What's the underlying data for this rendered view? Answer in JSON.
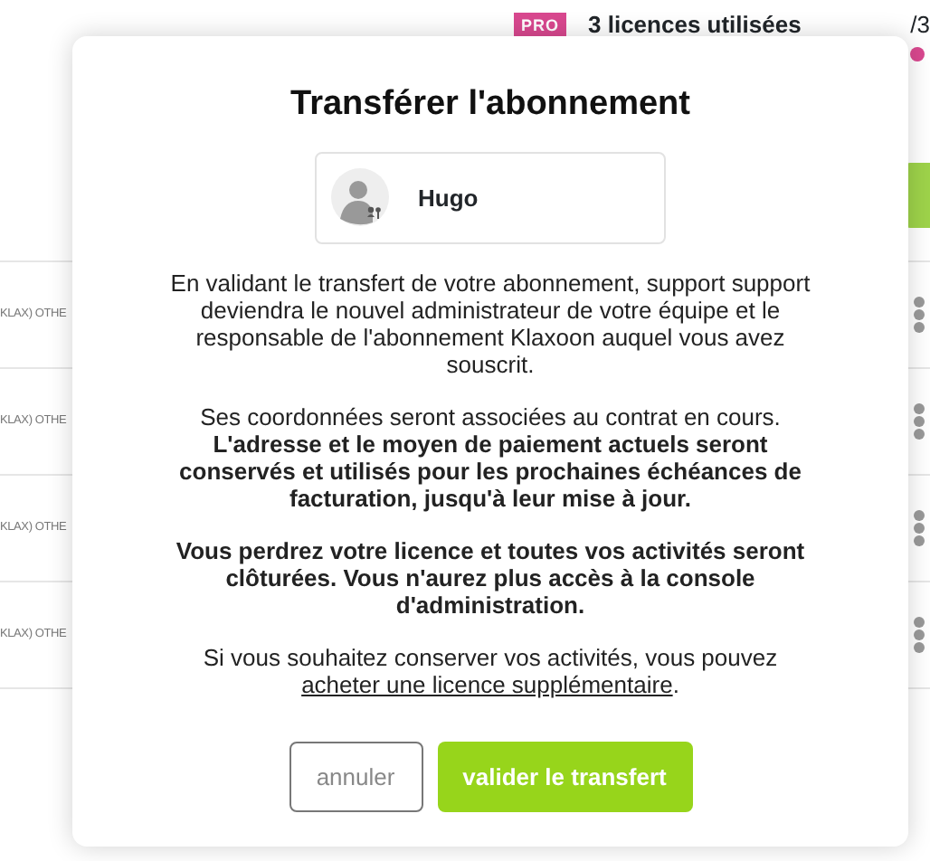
{
  "header": {
    "badge": "PRO",
    "licenses": "3 licences utilisées",
    "count": "/3"
  },
  "rows": [
    {
      "label": "KLAX) OTHE"
    },
    {
      "label": "KLAX) OTHE"
    },
    {
      "label": "KLAX) OTHE"
    },
    {
      "label": "KLAX) OTHE"
    }
  ],
  "dialog": {
    "title": "Transférer l'abonnement",
    "user": {
      "name": "Hugo"
    },
    "paragraphs": [
      {
        "text": "En validant le transfert de votre abonnement, support support deviendra le nouvel administrateur de votre équipe et le responsable de l'abonnement Klaxoon auquel vous avez souscrit.",
        "bold": false
      },
      {
        "text": "Ses coordonnées seront associées au contrat en cours. **L'adresse et le moyen de paiement actuels seront conservés et utilisés pour les prochaines échéances de facturation, jusqu'à leur mise à jour.**",
        "bold": false
      },
      {
        "text": "Vous perdrez votre licence et toutes vos activités seront clôturées. Vous n'aurez plus accès à la console d'administration.",
        "bold": true
      }
    ],
    "note": {
      "text": "Si vous souhaitez conserver vos activités, vous pouvez ",
      "link": "acheter une licence supplémentaire",
      "after": "."
    },
    "buttons": [
      {
        "label": "annuler",
        "kind": "secondary"
      },
      {
        "label": "valider le transfert",
        "kind": "primary"
      }
    ]
  }
}
